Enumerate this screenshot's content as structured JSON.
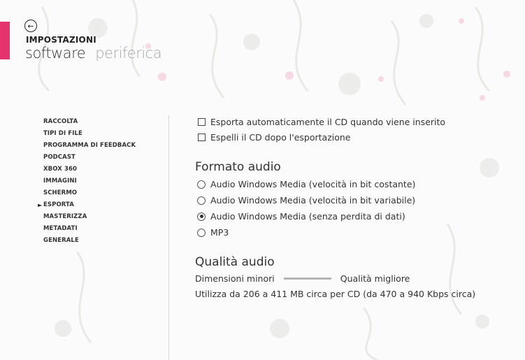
{
  "header": {
    "title": "IMPOSTAZIONI",
    "tabs": [
      {
        "label": "software",
        "active": true
      },
      {
        "label": "periferica",
        "active": false
      }
    ],
    "accent_color": "#e4336d"
  },
  "sidebar": {
    "items": [
      {
        "label": "RACCOLTA",
        "selected": false
      },
      {
        "label": "TIPI DI FILE",
        "selected": false
      },
      {
        "label": "PROGRAMMA DI FEEDBACK",
        "selected": false
      },
      {
        "label": "PODCAST",
        "selected": false
      },
      {
        "label": "XBOX 360",
        "selected": false
      },
      {
        "label": "IMMAGINI",
        "selected": false
      },
      {
        "label": "SCHERMO",
        "selected": false
      },
      {
        "label": "ESPORTA",
        "selected": true
      },
      {
        "label": "MASTERIZZA",
        "selected": false
      },
      {
        "label": "METADATI",
        "selected": false
      },
      {
        "label": "GENERALE",
        "selected": false
      }
    ]
  },
  "main": {
    "checkboxes": [
      {
        "label": "Esporta automaticamente il CD quando viene inserito",
        "checked": false
      },
      {
        "label": "Espelli il CD dopo l'esportazione",
        "checked": false
      }
    ],
    "audio_format": {
      "title": "Formato audio",
      "options": [
        {
          "label": "Audio Windows Media (velocità in bit costante)",
          "selected": false
        },
        {
          "label": "Audio Windows Media (velocità in bit variabile)",
          "selected": false
        },
        {
          "label": "Audio Windows Media (senza perdita di dati)",
          "selected": true
        },
        {
          "label": "MP3",
          "selected": false
        }
      ]
    },
    "audio_quality": {
      "title": "Qualità audio",
      "min_label": "Dimensioni minori",
      "max_label": "Qualità migliore",
      "info": "Utilizza da 206 a 411 MB circa per CD (da 470 a 940 Kbps circa)"
    }
  }
}
